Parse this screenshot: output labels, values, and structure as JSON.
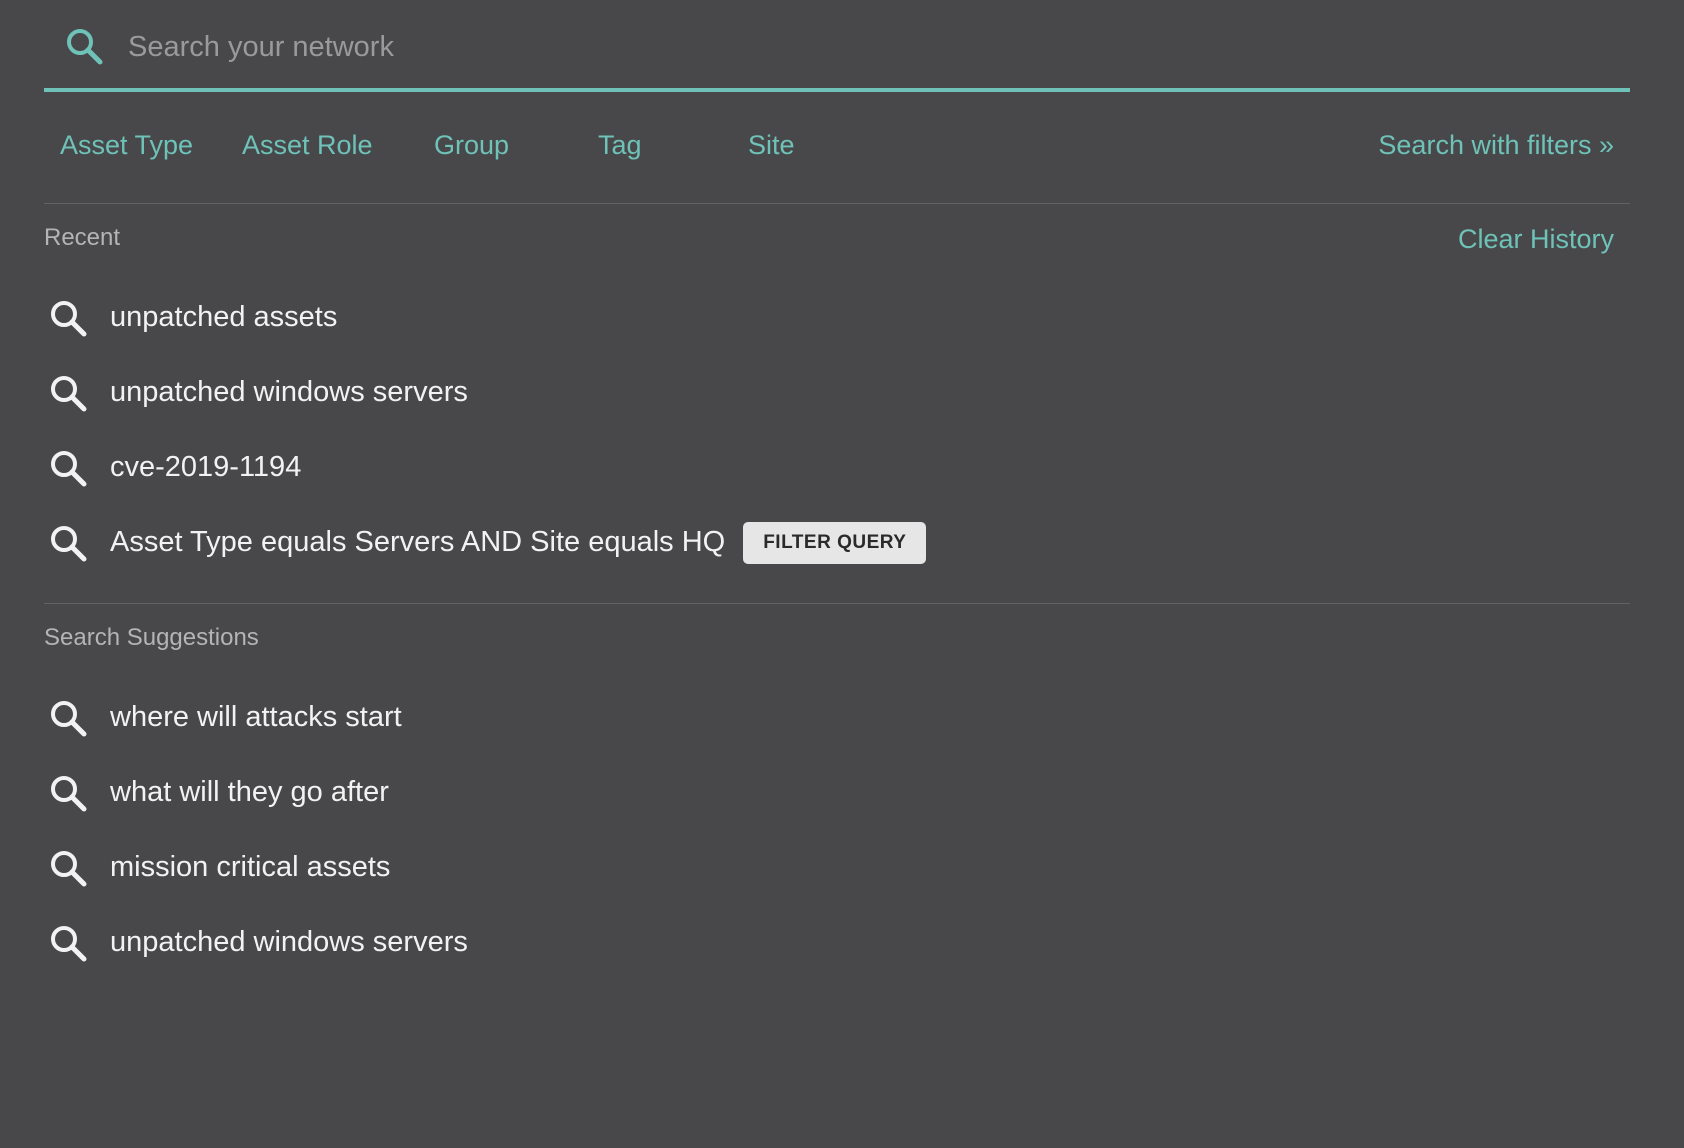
{
  "search": {
    "placeholder": "Search your network",
    "value": ""
  },
  "filters": {
    "tabs": [
      {
        "label": "Asset Type"
      },
      {
        "label": "Asset Role"
      },
      {
        "label": "Group"
      },
      {
        "label": "Tag"
      },
      {
        "label": "Site"
      }
    ],
    "search_with_filters_label": "Search with filters »"
  },
  "recent": {
    "title": "Recent",
    "clear_label": "Clear History",
    "items": [
      {
        "label": "unpatched assets"
      },
      {
        "label": "unpatched windows servers"
      },
      {
        "label": "cve-2019-1194"
      },
      {
        "label": "Asset Type equals Servers AND Site equals HQ",
        "badge": "FILTER QUERY"
      }
    ]
  },
  "suggestions": {
    "title": "Search Suggestions",
    "items": [
      {
        "label": "where will attacks start"
      },
      {
        "label": "what will they go after"
      },
      {
        "label": "mission critical assets"
      },
      {
        "label": "unpatched windows servers"
      }
    ]
  },
  "colors": {
    "background": "#48484a",
    "accent": "#6ec2b8",
    "text": "#f2f2f2",
    "muted": "#b4b4b6",
    "badge_bg": "#e6e6e6"
  },
  "icons": {
    "search_bar": "search-icon",
    "list_item": "search-icon"
  }
}
